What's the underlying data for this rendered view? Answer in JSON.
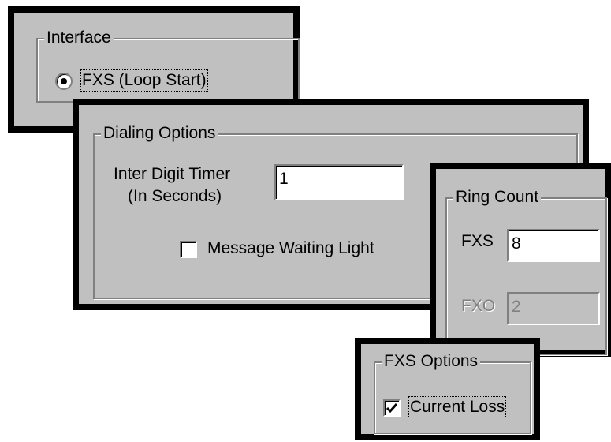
{
  "interface": {
    "title": "Interface",
    "option_label": "FXS (Loop Start)",
    "selected": true
  },
  "dialing_options": {
    "title": "Dialing Options",
    "inter_digit_label_line1": "Inter Digit Timer",
    "inter_digit_label_line2": "(In Seconds)",
    "inter_digit_value": "1",
    "message_waiting_label": "Message Waiting Light",
    "message_waiting_checked": false
  },
  "ring_count": {
    "title": "Ring Count",
    "fxs_label": "FXS",
    "fxs_value": "8",
    "fxo_label": "FXO",
    "fxo_value": "2"
  },
  "fxs_options": {
    "title": "FXS Options",
    "current_loss_label": "Current Loss",
    "current_loss_checked": true
  },
  "colors": {
    "dialog_face": "#c0c0c0",
    "frame": "#000000",
    "disabled_text": "#808080"
  }
}
